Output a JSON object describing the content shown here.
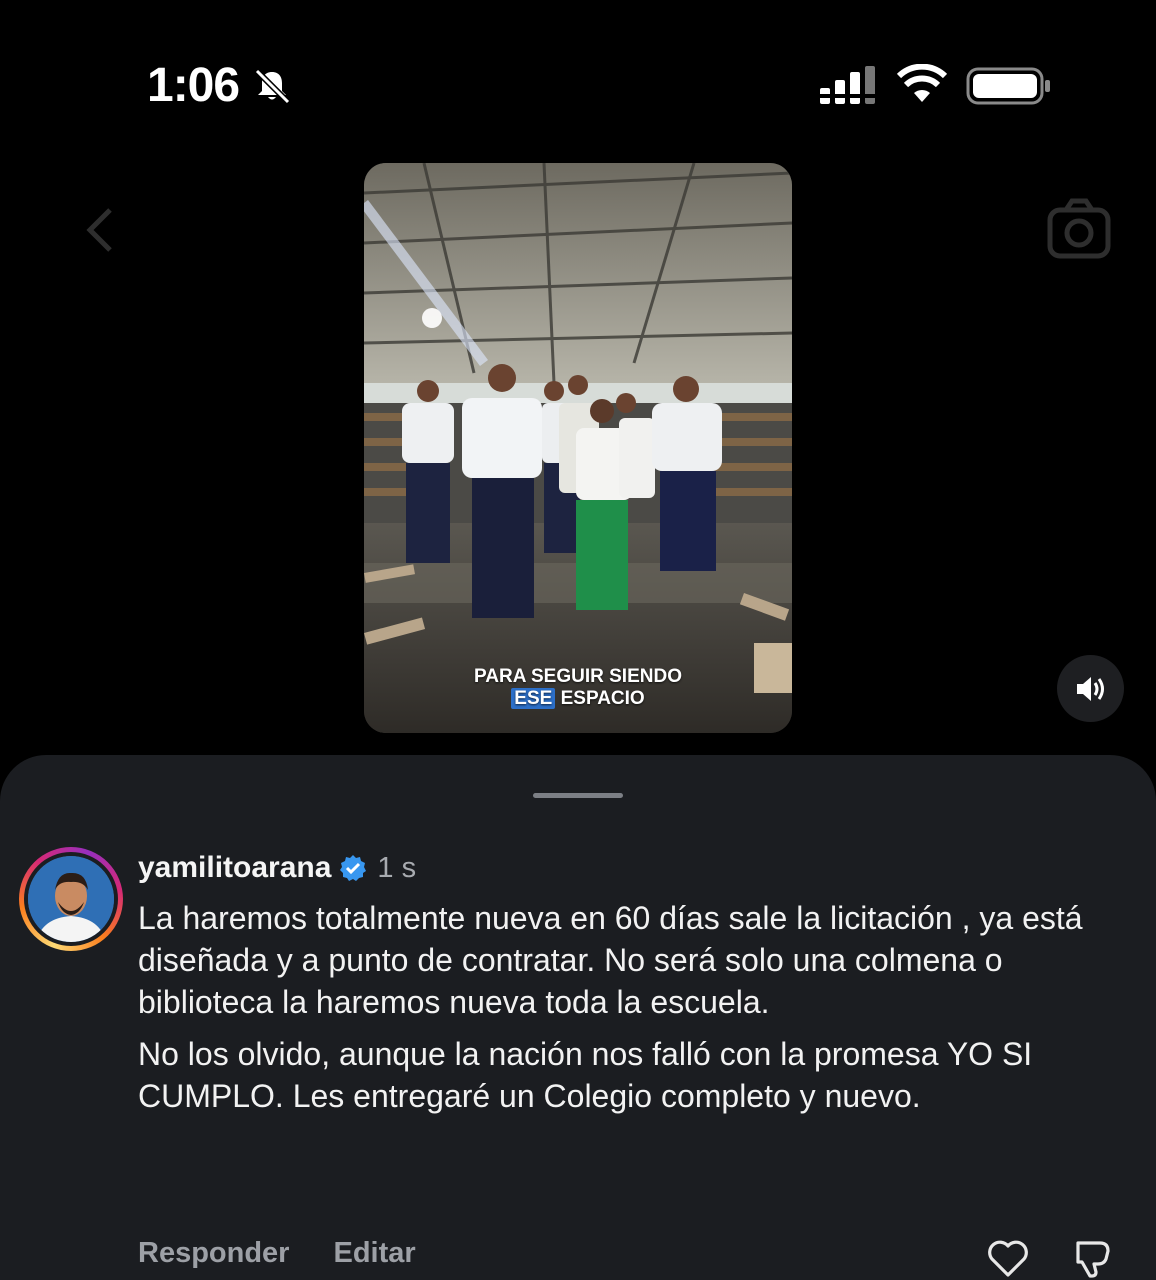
{
  "status_bar": {
    "time": "1:06",
    "icons": [
      "bell-slash-icon",
      "cellular-signal-icon",
      "wifi-icon",
      "battery-icon"
    ]
  },
  "header": {
    "icons": [
      "chevron-left-icon",
      "camera-icon"
    ]
  },
  "reel": {
    "caption_line1": "PARA SEGUIR SIENDO",
    "caption_highlight": "ESE",
    "caption_rest": "ESPACIO",
    "sound_icon": "speaker-volume-icon"
  },
  "comment": {
    "username": "yamilitoarana",
    "verified": true,
    "time": "1 s",
    "paragraph1": "La haremos totalmente nueva en 60 días sale la licitación , ya está diseñada y a punto de contratar. No será solo una colmena o biblioteca la haremos nueva toda la escuela.",
    "paragraph2": "No los olvido, aunque la nación nos falló con la promesa YO SI CUMPLO. Les entregaré un Colegio completo y nuevo.",
    "reply_label": "Responder",
    "edit_label": "Editar",
    "icons": [
      "heart-icon",
      "dislike-icon"
    ]
  },
  "colors": {
    "sheet_background": "#1b1d21",
    "verified_blue": "#3897f0",
    "caption_highlight": "#2c6fc8"
  }
}
